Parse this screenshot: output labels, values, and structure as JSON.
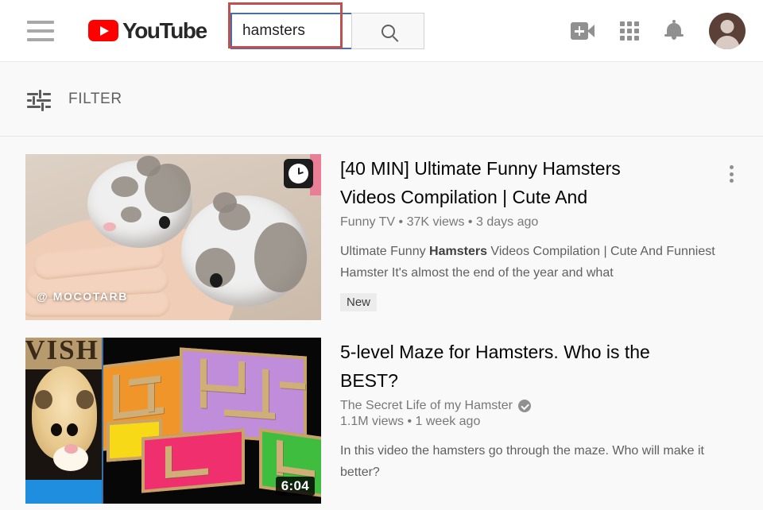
{
  "header": {
    "menu_icon": "hamburger-menu-icon",
    "logo_text": "YouTube",
    "search": {
      "value": "hamsters",
      "placeholder": "Search",
      "button_icon": "search-icon"
    },
    "actions": [
      {
        "icon": "video-camera-add-icon",
        "label": "Create"
      },
      {
        "icon": "apps-grid-icon",
        "label": "YouTube apps"
      },
      {
        "icon": "bell-icon",
        "label": "Notifications"
      },
      {
        "icon": "avatar-icon",
        "label": "Account"
      }
    ]
  },
  "filter": {
    "icon": "tune-filter-icon",
    "label": "FILTER"
  },
  "results": [
    {
      "title": "[40 MIN] Ultimate Funny Hamsters Videos Compilation | Cute And",
      "channel": "Funny TV",
      "verified": false,
      "views": "37K views",
      "age": "3 days ago",
      "meta_line": "Funny TV • 37K views • 3 days ago",
      "description_pre": "Ultimate Funny ",
      "description_bold": "Hamsters",
      "description_post": " Videos Compilation | Cute And Funniest Hamster It's almost the end of the year and what",
      "badge": "New",
      "thumbnail": {
        "watermark": "@ MOCOTARB",
        "overlay_icon": "watch-later-clock-icon",
        "duration": ""
      },
      "menu_icon": "more-options-kebab-icon"
    },
    {
      "title": "5-level Maze for Hamsters. Who is the BEST?",
      "channel": "The Secret Life of my Hamster",
      "verified": true,
      "views": "1.1M views",
      "age": "1 week ago",
      "meta_line": "1.1M views • 1 week ago",
      "description_pre": "In this video the hamsters go through the maze. Who will make it better?",
      "description_bold": "",
      "description_post": "",
      "badge": "",
      "thumbnail": {
        "watermark": "VISH",
        "overlay_icon": "",
        "duration": "6:04"
      },
      "menu_icon": "more-options-kebab-icon"
    }
  ],
  "annotation": {
    "type": "highlight-rectangle",
    "color": "#c0504d",
    "target": "search-input"
  },
  "colors": {
    "brand_red": "#ff0000",
    "page_bg": "#f9f9f9",
    "header_bg": "#ffffff",
    "text_primary": "#030303",
    "text_secondary": "#787878",
    "focus_border": "#4a6fa5"
  }
}
